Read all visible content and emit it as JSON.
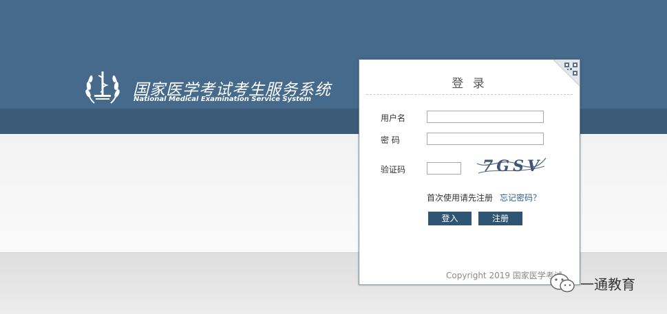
{
  "header": {
    "title": "国家医学考试考生服务系统",
    "subtitle": "National Medical Examination Service System",
    "logo_icon": "medical-emblem-icon"
  },
  "login": {
    "title": "登 录",
    "username_label": "用户名",
    "username_value": "",
    "password_label": "密 码",
    "password_value": "",
    "captcha_label": "验证码",
    "captcha_value": "",
    "captcha_text": "7GSV",
    "first_use_link": "首次使用请先注册",
    "forgot_link": "忘记密码？",
    "login_button": "登入",
    "register_button": "注册",
    "copyright": "Copyright 2019 国家医学考试"
  },
  "watermark": {
    "text": "一通教育",
    "icon": "wechat-icon"
  },
  "colors": {
    "header": "#456a8b",
    "header_band": "#3b5b77",
    "button": "#2f5575",
    "link": "#2b5d8c"
  }
}
